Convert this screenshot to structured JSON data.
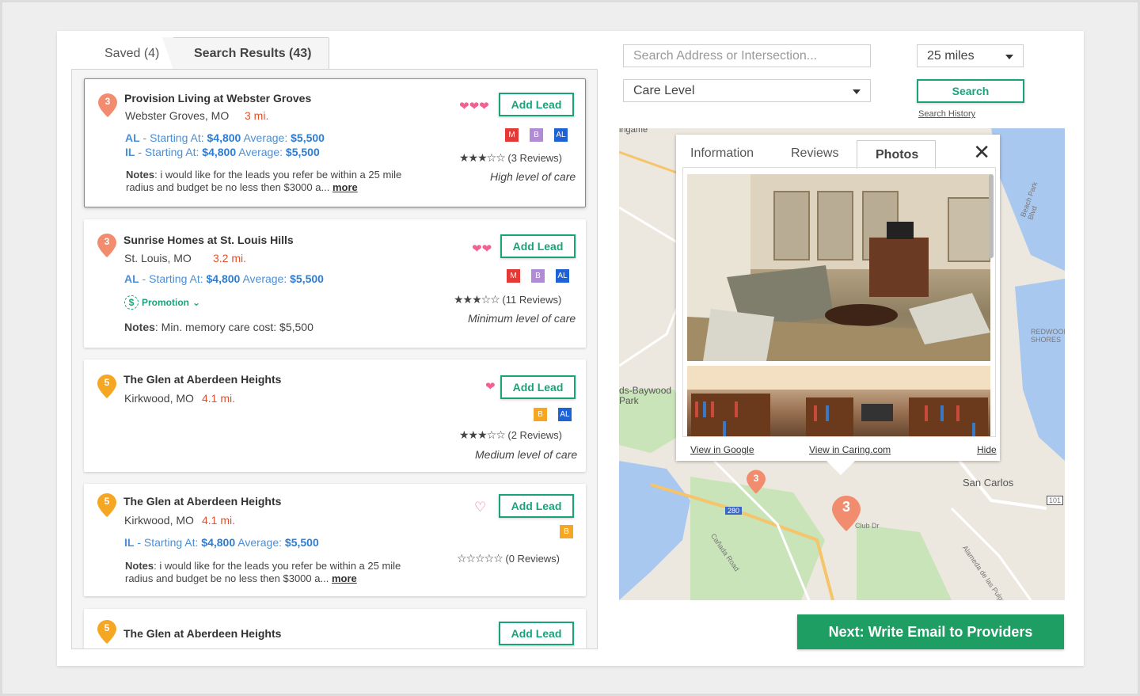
{
  "tabs": {
    "saved": "Saved (4)",
    "results": "Search Results (43)"
  },
  "search": {
    "address_placeholder": "Search Address or Intersection...",
    "radius": "25 miles",
    "care_level": "Care Level",
    "search_label": "Search",
    "history_label": "Search History"
  },
  "listings": [
    {
      "pin": "3",
      "name": "Provision Living at Webster Groves",
      "city": "Webster Groves, MO",
      "distance": "3 mi.",
      "prices": [
        {
          "type": "AL",
          "start": "$4,800",
          "avg": "$5,500"
        },
        {
          "type": "IL",
          "start": "$4,800",
          "avg": "$5,500"
        }
      ],
      "starting_label": "Starting At:",
      "average_label": "Average:",
      "notes_label": "Notes",
      "notes": ": i would like for the leads you refer be within a 25 mile radius and budget be no less then $3000 a...",
      "more": "more",
      "hearts": "❤❤❤",
      "add_lead": "Add Lead",
      "badges": [
        "M",
        "B",
        "AL"
      ],
      "stars": "★★★☆☆",
      "reviews": "(3 Reviews)",
      "care": "High level of care"
    },
    {
      "pin": "3",
      "name": "Sunrise Homes at St. Louis Hills",
      "city": "St. Louis, MO",
      "distance": "3.2 mi.",
      "prices": [
        {
          "type": "AL",
          "start": "$4,800",
          "avg": "$5,500"
        }
      ],
      "promotion": "Promotion",
      "notes_label": "Notes",
      "notes": ": Min. memory care cost: $5,500",
      "hearts": "❤❤",
      "add_lead": "Add Lead",
      "badges": [
        "M",
        "B",
        "AL"
      ],
      "stars": "★★★☆☆",
      "reviews": "(11 Reviews)",
      "care": "Minimum level of care"
    },
    {
      "pin": "5",
      "name": "The Glen at Aberdeen Heights",
      "city": "Kirkwood, MO",
      "distance": "4.1 mi.",
      "hearts": "❤",
      "add_lead": "Add Lead",
      "badges": [
        "B",
        "AL"
      ],
      "stars": "★★★☆☆",
      "reviews": "(2 Reviews)",
      "care": "Medium level of care"
    },
    {
      "pin": "5",
      "name": "The Glen at Aberdeen Heights",
      "city": "Kirkwood, MO",
      "distance": "4.1 mi.",
      "prices": [
        {
          "type": "IL",
          "start": "$4,800",
          "avg": "$5,500"
        }
      ],
      "notes_label": "Notes",
      "notes": ": i would like for the leads you refer be within a 25 mile radius and budget be no less then $3000 a...",
      "more": "more",
      "hearts": "♡",
      "add_lead": "Add Lead",
      "badges": [
        "B"
      ],
      "stars": "☆☆☆☆☆",
      "reviews": "(0 Reviews)"
    },
    {
      "pin": "5",
      "name": "The Glen at Aberdeen Heights",
      "add_lead": "Add Lead"
    }
  ],
  "popup": {
    "tab_info": "Information",
    "tab_reviews": "Reviews",
    "tab_photos": "Photos",
    "close": "✕",
    "view_google": "View in Google",
    "view_caring": "View in Caring.com",
    "hide": "Hide"
  },
  "map": {
    "labels": {
      "san_carlos": "San Carlos",
      "park": "ds-Baywood\nPark",
      "redwood": "REDWOOD\nSHORES",
      "club_dr": "Club Dr",
      "canada_road": "Cañada Road",
      "alameda": "Alameda de las Pulgas",
      "beach_park": "Beach Park Blvd",
      "i280": "280",
      "us101": "101",
      "top_road": "ingame"
    },
    "pins": [
      "3",
      "3"
    ]
  },
  "next_label": "Next: Write Email to Providers"
}
